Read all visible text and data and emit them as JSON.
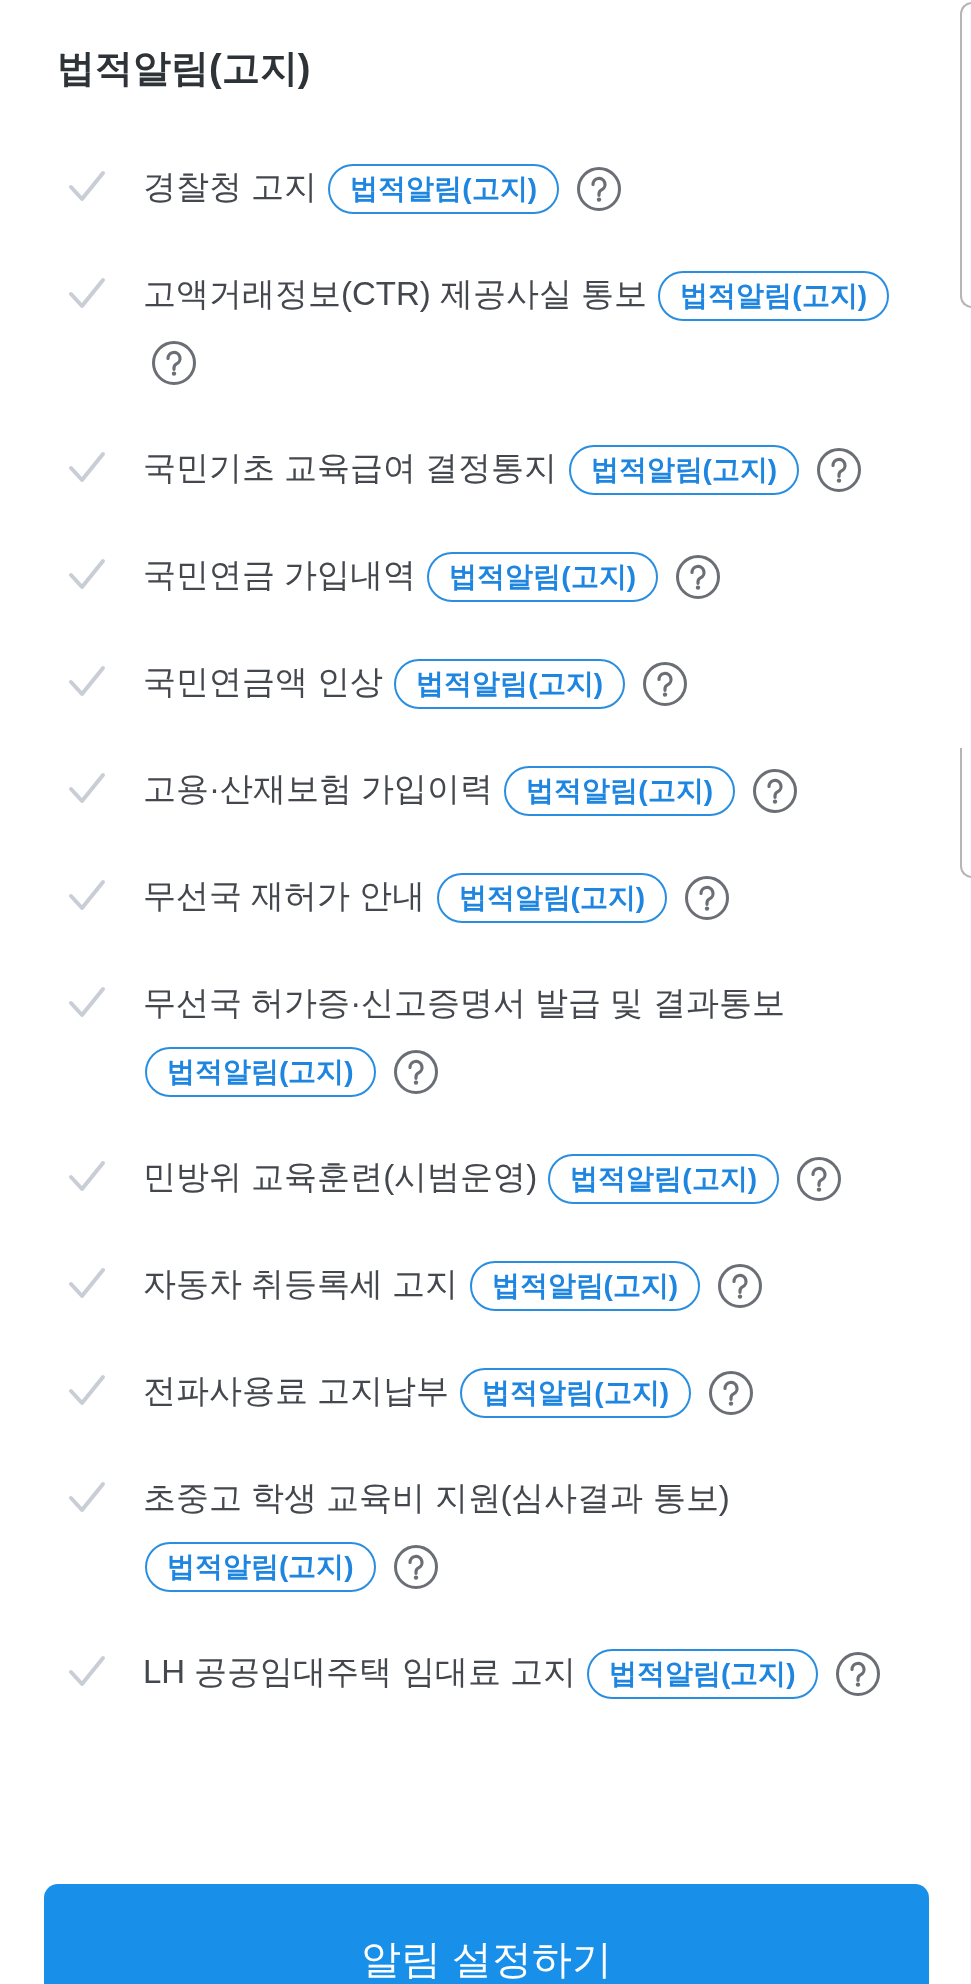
{
  "title": "법적알림(고지)",
  "items": [
    {
      "label": "경찰청 고지",
      "badge": "법적알림(고지)"
    },
    {
      "label": "고액거래정보(CTR) 제공사실 통보",
      "badge": "법적알림(고지)"
    },
    {
      "label": "국민기초 교육급여 결정통지",
      "badge": "법적알림(고지)"
    },
    {
      "label": "국민연금 가입내역",
      "badge": "법적알림(고지)"
    },
    {
      "label": "국민연금액 인상",
      "badge": "법적알림(고지)"
    },
    {
      "label": "고용·산재보험 가입이력",
      "badge": "법적알림(고지)"
    },
    {
      "label": "무선국 재허가 안내",
      "badge": "법적알림(고지)"
    },
    {
      "label": "무선국 허가증·신고증명서 발급 및 결과통보",
      "badge": "법적알림(고지)"
    },
    {
      "label": "민방위 교육훈련(시범운영)",
      "badge": "법적알림(고지)"
    },
    {
      "label": "자동차 취등록세 고지",
      "badge": "법적알림(고지)"
    },
    {
      "label": "전파사용료 고지납부",
      "badge": "법적알림(고지)"
    },
    {
      "label": "초중고 학생 교육비 지원(심사결과 통보)",
      "badge": "법적알림(고지)"
    },
    {
      "label": "LH 공공임대주택 임대료 고지",
      "badge": "법적알림(고지)"
    }
  ],
  "button": {
    "label": "알림 설정하기"
  }
}
